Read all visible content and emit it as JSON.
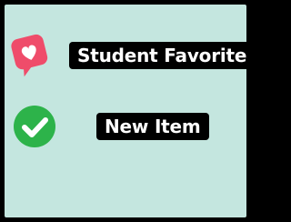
{
  "badges": [
    {
      "label": "Student Favorite",
      "icon": "heart-speech-bubble-icon",
      "color": "#ef4c6a"
    },
    {
      "label": "New Item",
      "icon": "check-circle-icon",
      "color": "#2db34a"
    }
  ],
  "colors": {
    "background": "#c4e6df",
    "label_background": "#000000",
    "label_text": "#ffffff"
  }
}
